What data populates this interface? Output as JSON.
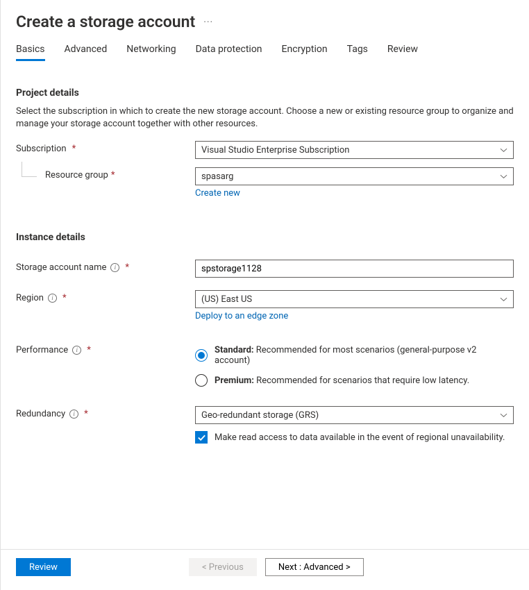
{
  "header": {
    "title": "Create a storage account"
  },
  "tabs": [
    {
      "label": "Basics",
      "active": true
    },
    {
      "label": "Advanced",
      "active": false
    },
    {
      "label": "Networking",
      "active": false
    },
    {
      "label": "Data protection",
      "active": false
    },
    {
      "label": "Encryption",
      "active": false
    },
    {
      "label": "Tags",
      "active": false
    },
    {
      "label": "Review",
      "active": false
    }
  ],
  "project": {
    "heading": "Project details",
    "description": "Select the subscription in which to create the new storage account. Choose a new or existing resource group to organize and manage your storage account together with other resources.",
    "subscription_label": "Subscription",
    "subscription_value": "Visual Studio Enterprise Subscription",
    "resource_group_label": "Resource group",
    "resource_group_value": "spasarg",
    "create_new_link": "Create new"
  },
  "instance": {
    "heading": "Instance details",
    "name_label": "Storage account name",
    "name_value": "spstorage1128",
    "region_label": "Region",
    "region_value": "(US) East US",
    "edge_link": "Deploy to an edge zone",
    "performance_label": "Performance",
    "perf_standard_bold": "Standard:",
    "perf_standard_rest": " Recommended for most scenarios (general-purpose v2 account)",
    "perf_premium_bold": "Premium:",
    "perf_premium_rest": " Recommended for scenarios that require low latency.",
    "redundancy_label": "Redundancy",
    "redundancy_value": "Geo-redundant storage (GRS)",
    "ra_label": "Make read access to data available in the event of regional unavailability."
  },
  "footer": {
    "review": "Review",
    "previous": "< Previous",
    "next": "Next : Advanced >"
  }
}
